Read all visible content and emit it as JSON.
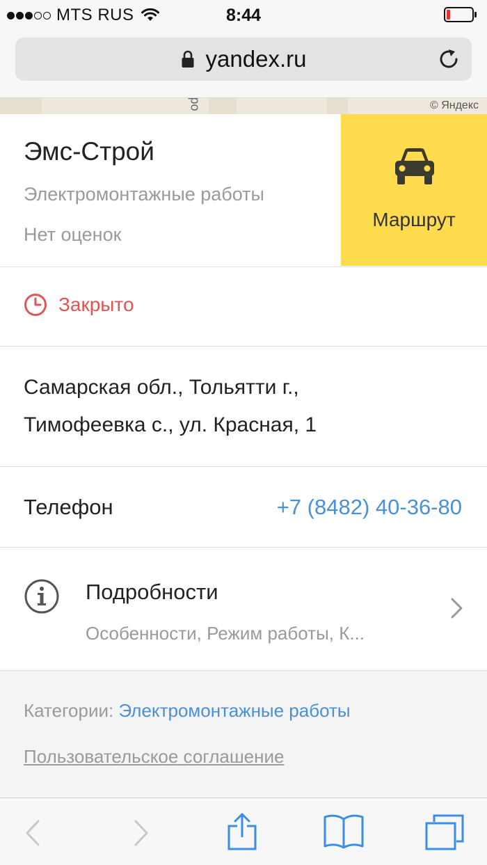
{
  "status_bar": {
    "carrier": "MTS RUS",
    "time": "8:44"
  },
  "browser": {
    "url": "yandex.ru"
  },
  "map": {
    "attribution": "© Яндекс",
    "road_label": "ро"
  },
  "organization": {
    "name": "Эмс-Строй",
    "category": "Электромонтажные работы",
    "rating": "Нет оценок",
    "route_label": "Маршрут"
  },
  "hours": {
    "status": "Закрыто"
  },
  "address": {
    "line1": "Самарская обл., Тольятти г.,",
    "line2": "Тимофеевка с., ул. Красная, 1"
  },
  "phone": {
    "label": "Телефон",
    "value": "+7 (8482) 40-36-80"
  },
  "details": {
    "title": "Подробности",
    "subtitle": "Особенности, Режим работы, К..."
  },
  "footer": {
    "categories_label": "Категории:",
    "categories_value": "Электромонтажные работы",
    "agreement": "Пользовательское соглашение"
  },
  "colors": {
    "route_button": "#ffdb4d",
    "closed_red": "#e05555",
    "link_blue": "#4a90d9",
    "ios_blue": "#3a8ee6"
  }
}
